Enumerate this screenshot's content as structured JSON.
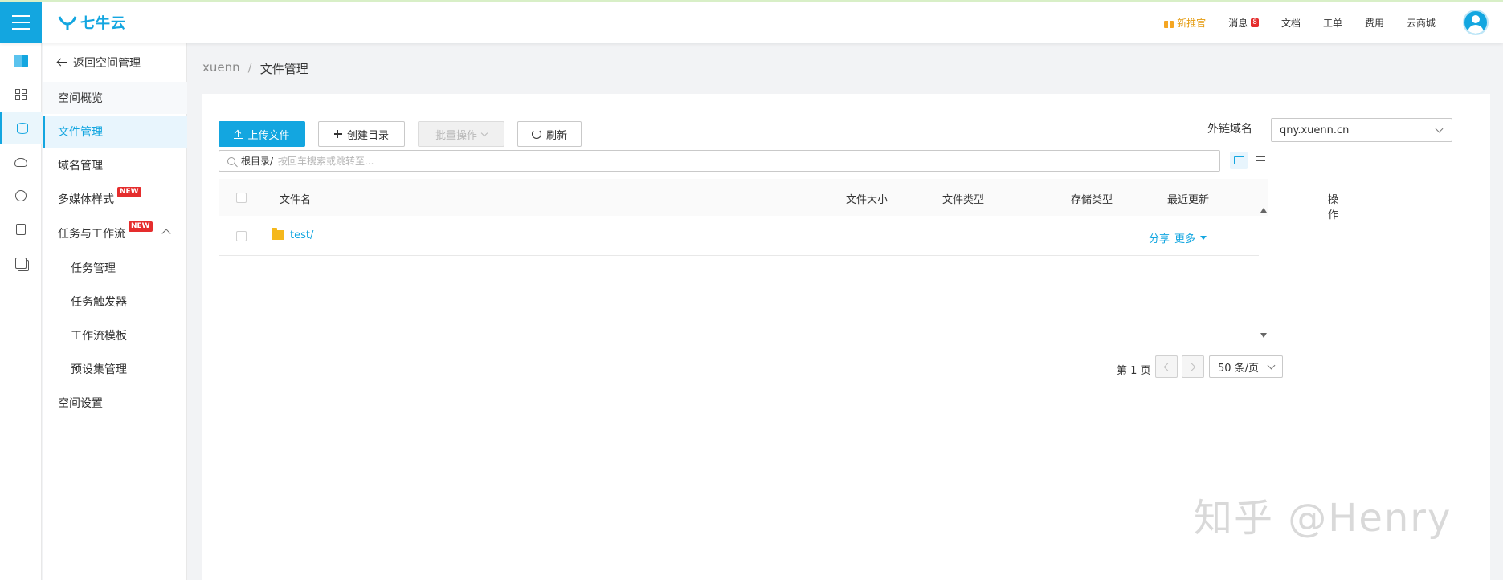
{
  "app": {
    "logo_text": "七牛云"
  },
  "top_nav": {
    "promo": "新推官",
    "messages": "消息",
    "messages_badge": "8",
    "docs": "文档",
    "tickets": "工单",
    "billing": "费用",
    "marketplace": "云商城"
  },
  "sidebar": {
    "back": "返回空间管理",
    "items": [
      {
        "label": "空间概览"
      },
      {
        "label": "文件管理"
      },
      {
        "label": "域名管理"
      },
      {
        "label": "多媒体样式",
        "tag": "NEW"
      },
      {
        "label": "任务与工作流",
        "tag": "NEW"
      },
      {
        "label": "任务管理"
      },
      {
        "label": "任务触发器"
      },
      {
        "label": "工作流模板"
      },
      {
        "label": "预设集管理"
      },
      {
        "label": "空间设置"
      }
    ]
  },
  "breadcrumb": {
    "root": "xuenn",
    "separator": "/",
    "current": "文件管理"
  },
  "toolbar": {
    "upload": "上传文件",
    "create_dir": "创建目录",
    "batch": "批量操作",
    "refresh": "刷新",
    "domain_label": "外链域名",
    "domain_value": "qny.xuenn.cn"
  },
  "search": {
    "prefix": "根目录/",
    "placeholder": "按回车搜索或跳转至..."
  },
  "table": {
    "headers": [
      "文件名",
      "文件大小",
      "文件类型",
      "存储类型",
      "最近更新",
      "操作"
    ],
    "rows": [
      {
        "name": "test/",
        "share": "分享",
        "more": "更多"
      }
    ]
  },
  "pagination": {
    "page_label": "第 1 页",
    "per_page": "50 条/页"
  },
  "watermark": "知乎 @Henry",
  "colors": {
    "accent": "#13a6e0",
    "badge": "#e52d2d",
    "folder": "#f5b81c",
    "promo": "#e49b0f"
  }
}
